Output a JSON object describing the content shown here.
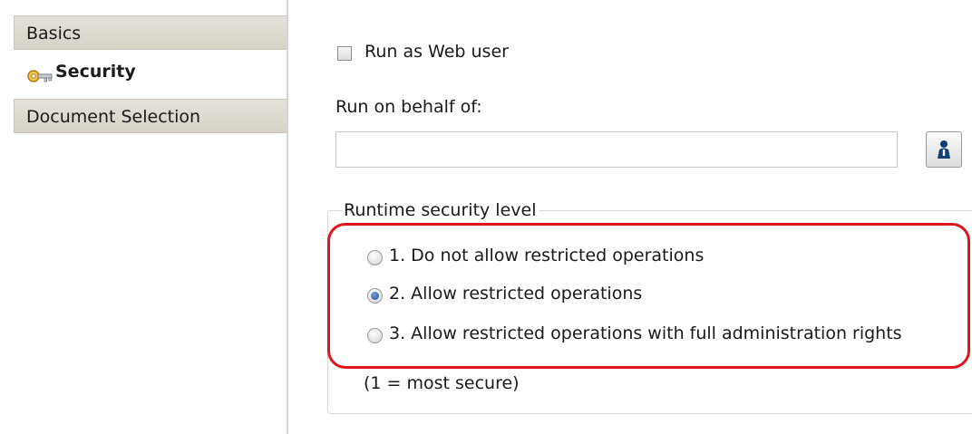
{
  "sidebar": {
    "items": [
      {
        "label": "Basics"
      },
      {
        "label": "Security",
        "icon": "key-icon"
      },
      {
        "label": "Document Selection"
      }
    ]
  },
  "main": {
    "run_as_web_user": {
      "label": "Run as Web user",
      "checked": false
    },
    "run_on_behalf": {
      "label": "Run on behalf of:",
      "value": "",
      "picker_icon": "person-icon"
    },
    "security_group": {
      "title": "Runtime security level",
      "options": [
        {
          "label": "1. Do not allow restricted operations",
          "checked": false
        },
        {
          "label": "2. Allow restricted operations",
          "checked": true
        },
        {
          "label": "3. Allow restricted operations with full administration rights",
          "checked": false
        }
      ],
      "note": "(1 = most secure)"
    }
  },
  "colors": {
    "highlight": "#e0141b",
    "tab_bg": "#ddd9ce",
    "radio_selected": "#1e4f8f"
  }
}
